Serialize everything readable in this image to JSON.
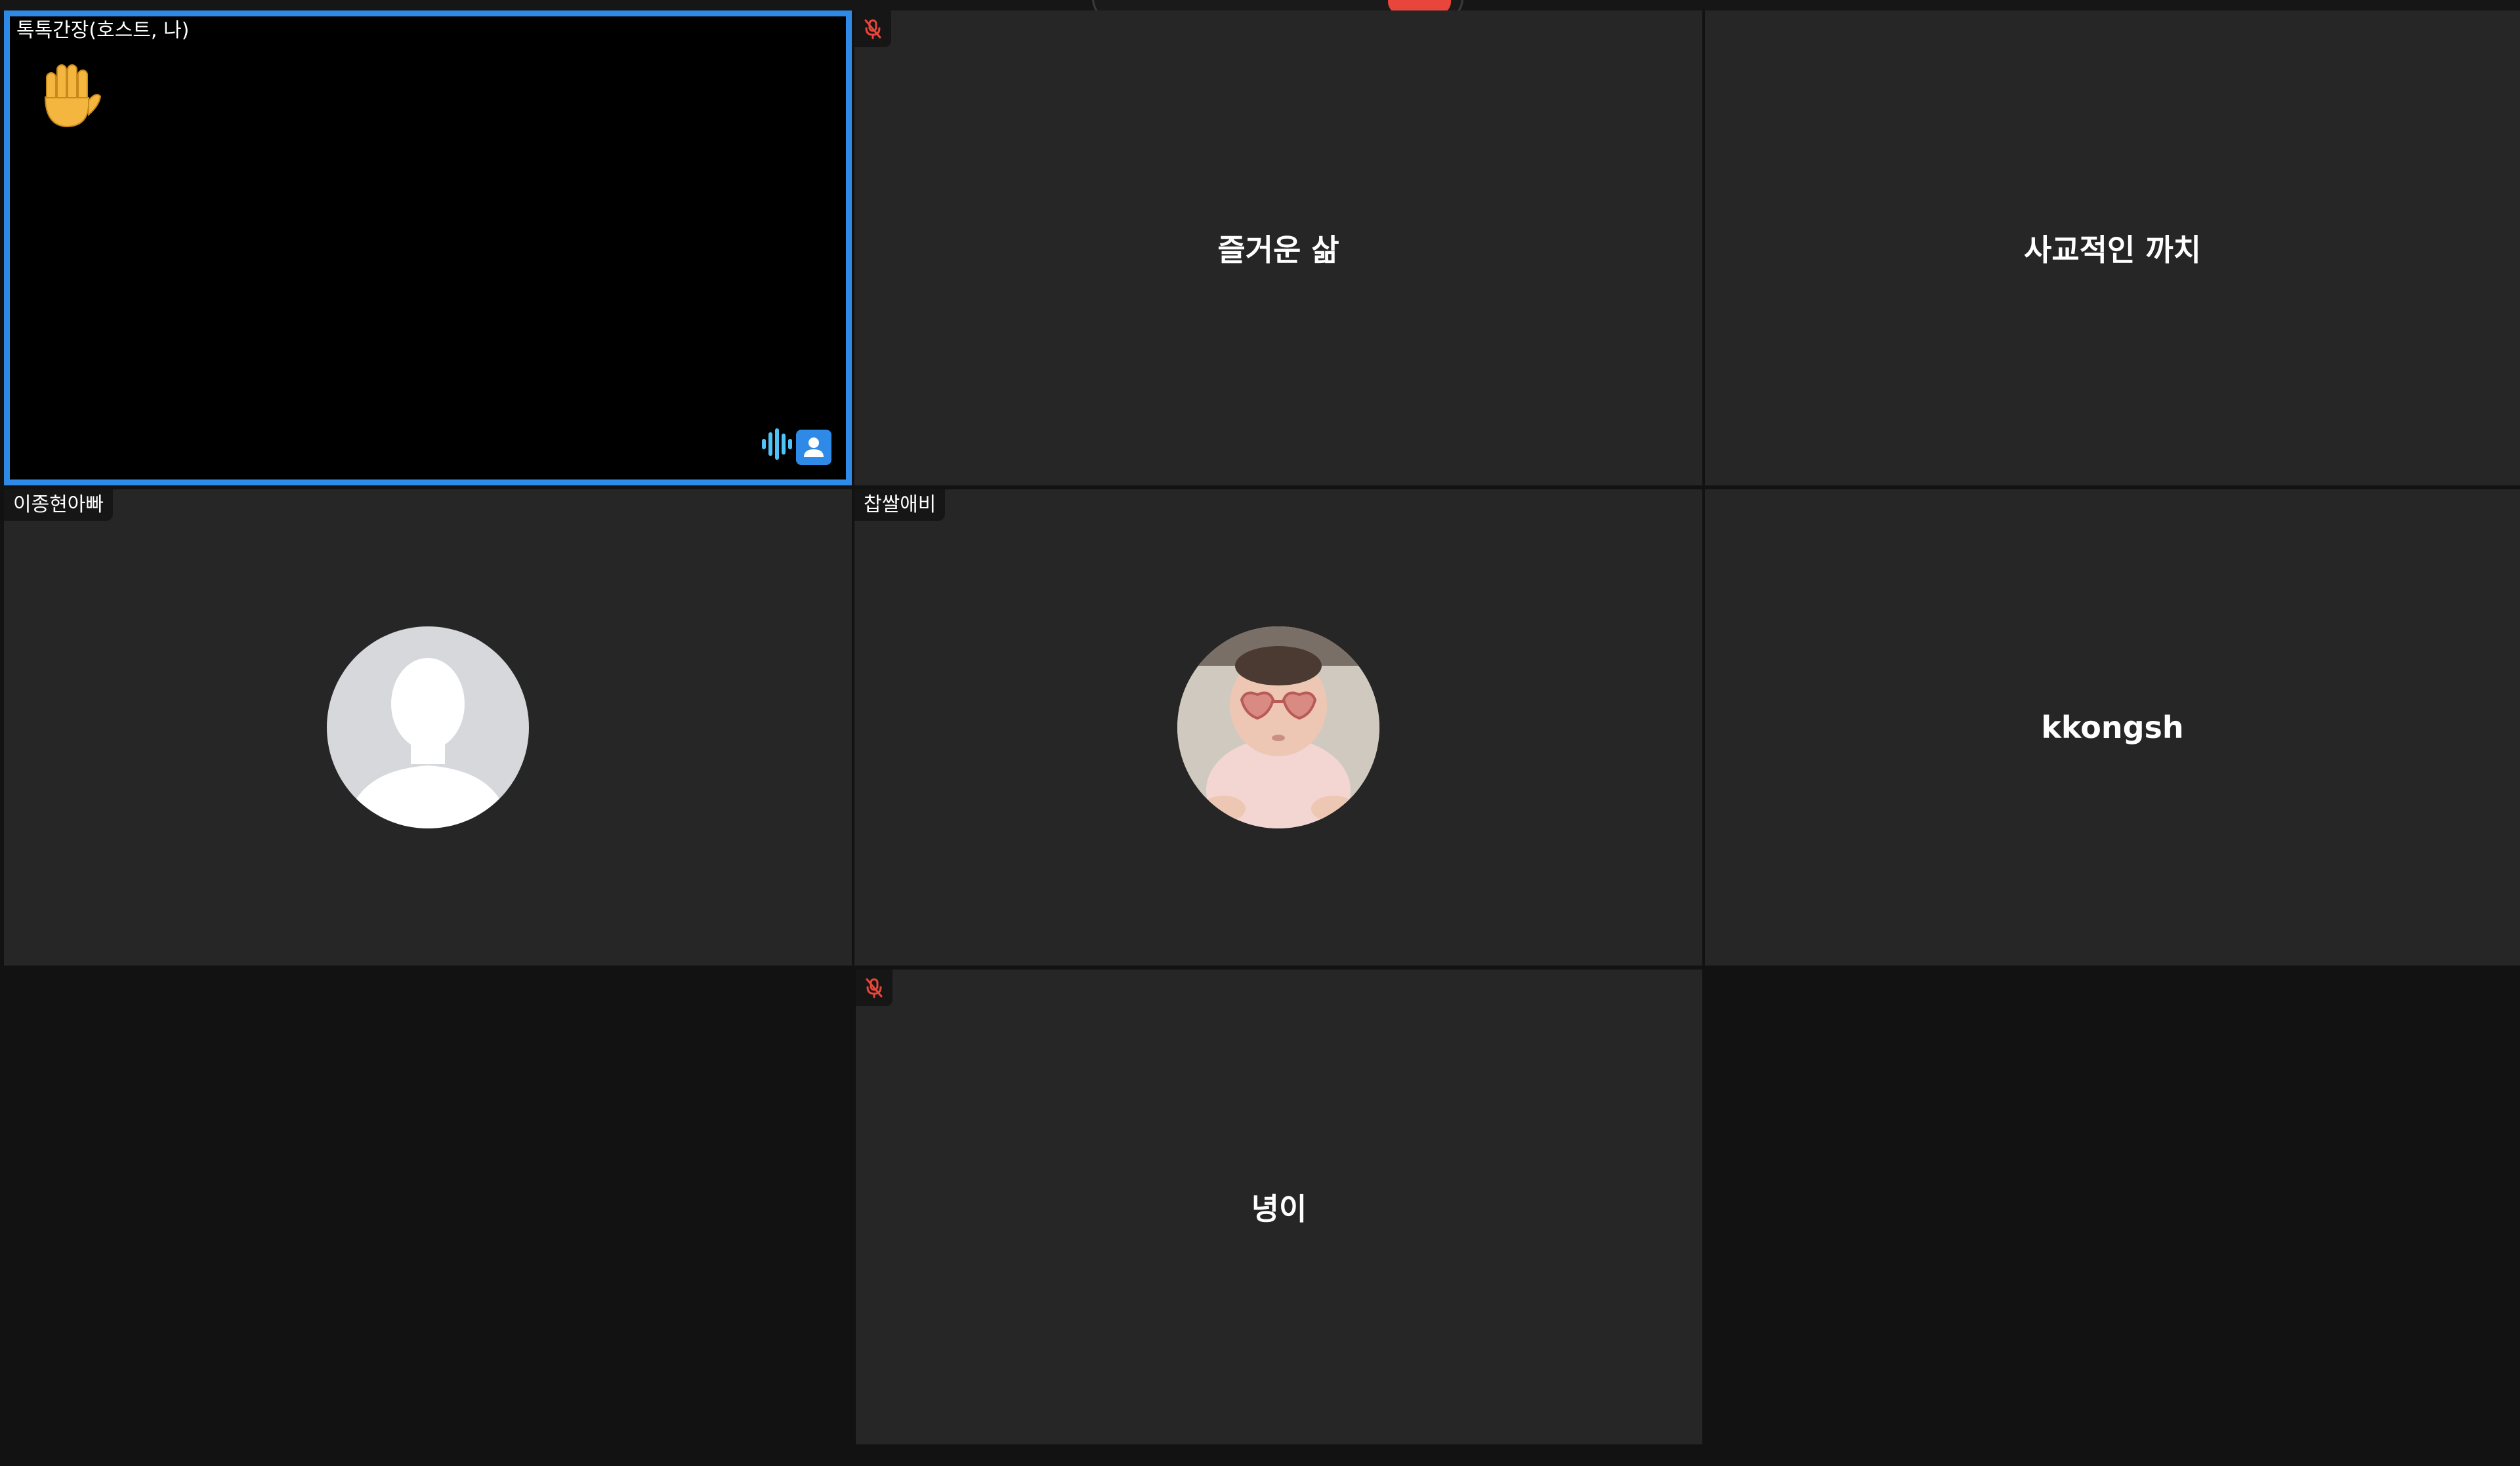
{
  "colors": {
    "background": "#121212",
    "tile": "#262626",
    "active_border": "#2e8ae6",
    "muted_icon": "#e8463a",
    "audio_bars": "#4fc3f7"
  },
  "participants": [
    {
      "name": "톡톡간장(호스트, 나)",
      "video": "off-black",
      "active_speaker": true,
      "reaction": "raised-hand",
      "indicators": [
        "audio-icon",
        "video-off-icon"
      ]
    },
    {
      "name": "즐거운 삶",
      "muted": true
    },
    {
      "name": "사교적인 까치"
    },
    {
      "name": "이종현아빠",
      "avatar": "default-person-icon"
    },
    {
      "name": "찹쌀애비",
      "avatar": "baby-photo"
    },
    {
      "name": "kkongsh"
    },
    {
      "name": "녕이",
      "muted": true
    }
  ]
}
